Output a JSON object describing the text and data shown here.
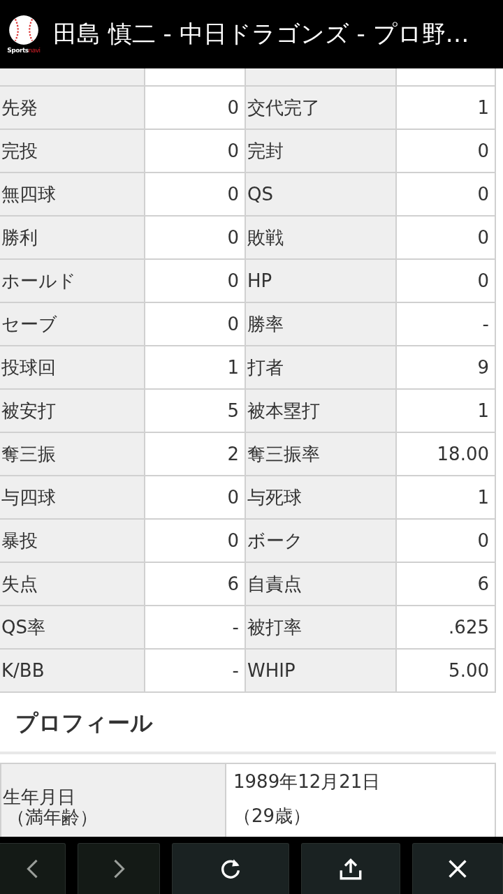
{
  "header": {
    "logo_text": [
      "Sports",
      "navi"
    ],
    "title": "田島 慎二 - 中日ドラゴンズ - プロ野…"
  },
  "stats": [
    {
      "label_1": "先発",
      "value_1": "0",
      "label_2": "交代完了",
      "value_2": "1"
    },
    {
      "label_1": "完投",
      "value_1": "0",
      "label_2": "完封",
      "value_2": "0"
    },
    {
      "label_1": "無四球",
      "value_1": "0",
      "label_2": "QS",
      "value_2": "0"
    },
    {
      "label_1": "勝利",
      "value_1": "0",
      "label_2": "敗戦",
      "value_2": "0"
    },
    {
      "label_1": "ホールド",
      "value_1": "0",
      "label_2": "HP",
      "value_2": "0"
    },
    {
      "label_1": "セーブ",
      "value_1": "0",
      "label_2": "勝率",
      "value_2": "-"
    },
    {
      "label_1": "投球回",
      "value_1": "1",
      "label_2": "打者",
      "value_2": "9"
    },
    {
      "label_1": "被安打",
      "value_1": "5",
      "label_2": "被本塁打",
      "value_2": "1"
    },
    {
      "label_1": "奪三振",
      "value_1": "2",
      "label_2": "奪三振率",
      "value_2": "18.00"
    },
    {
      "label_1": "与四球",
      "value_1": "0",
      "label_2": "与死球",
      "value_2": "1"
    },
    {
      "label_1": "暴投",
      "value_1": "0",
      "label_2": "ボーク",
      "value_2": "0"
    },
    {
      "label_1": "失点",
      "value_1": "6",
      "label_2": "自責点",
      "value_2": "6"
    },
    {
      "label_1": "QS率",
      "value_1": "-",
      "label_2": "被打率",
      "value_2": ".625"
    },
    {
      "label_1": "K/BB",
      "value_1": "-",
      "label_2": "WHIP",
      "value_2": "5.00"
    }
  ],
  "profile": {
    "heading": "プロフィール",
    "rows": [
      {
        "label": [
          "生年月日",
          "（満年齢）"
        ],
        "value": [
          "1989年12月21日",
          "（29歳）"
        ]
      }
    ]
  },
  "toolbar": [
    {
      "kind": "back"
    },
    {
      "kind": "forward"
    },
    {
      "kind": "reload"
    },
    {
      "kind": "share"
    },
    {
      "kind": "close"
    }
  ]
}
